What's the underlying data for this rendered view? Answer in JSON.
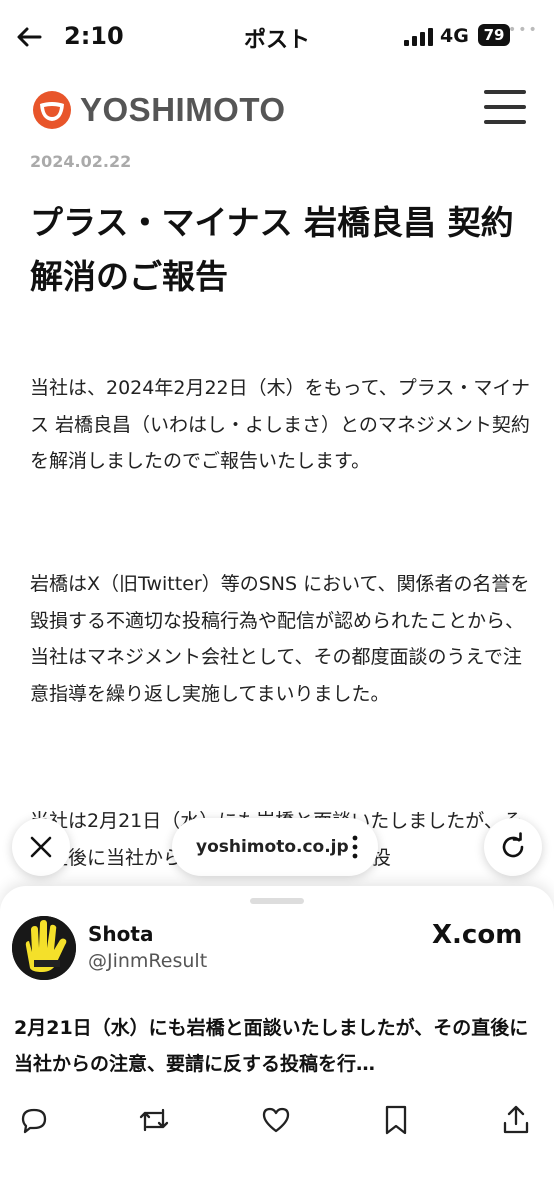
{
  "status_bar": {
    "time": "2:10",
    "screen_title": "ポスト",
    "network": "4G",
    "battery": "79"
  },
  "site": {
    "logo_text": "YOSHIMOTO"
  },
  "article": {
    "date": "2024.02.22",
    "title": "プラス・マイナス 岩橋良昌 契約解消のご報告",
    "paragraphs": [
      "当社は、2024年2月22日（木）をもって、プラス・マイナス 岩橋良昌（いわはし・よしまさ）とのマネジメント契約を解消しましたのでご報告いたします。",
      "岩橋はX（旧Twitter）等のSNS において、関係者の名誉を毀損する不適切な投稿行為や配信が認められたことから、当社はマネジメント会社として、その都度面談のうえで注意指導を繰り返し実施してまいりました。",
      "当社は2月21日（水）にも岩橋と面談いたしましたが、その直後に当社からの注意、要請に反する投"
    ]
  },
  "browser": {
    "url": "yoshimoto.co.jp"
  },
  "post": {
    "author_name": "Shota",
    "author_handle": "@JinmResult",
    "source": "X.com",
    "text": "2月21日（水）にも岩橋と面談いたしましたが、その直後に当社からの注意、要請に反する投稿を行…"
  },
  "colors": {
    "brand_orange": "#e8552a",
    "logo_gray": "#555555",
    "date_gray": "#aaaaaa"
  }
}
